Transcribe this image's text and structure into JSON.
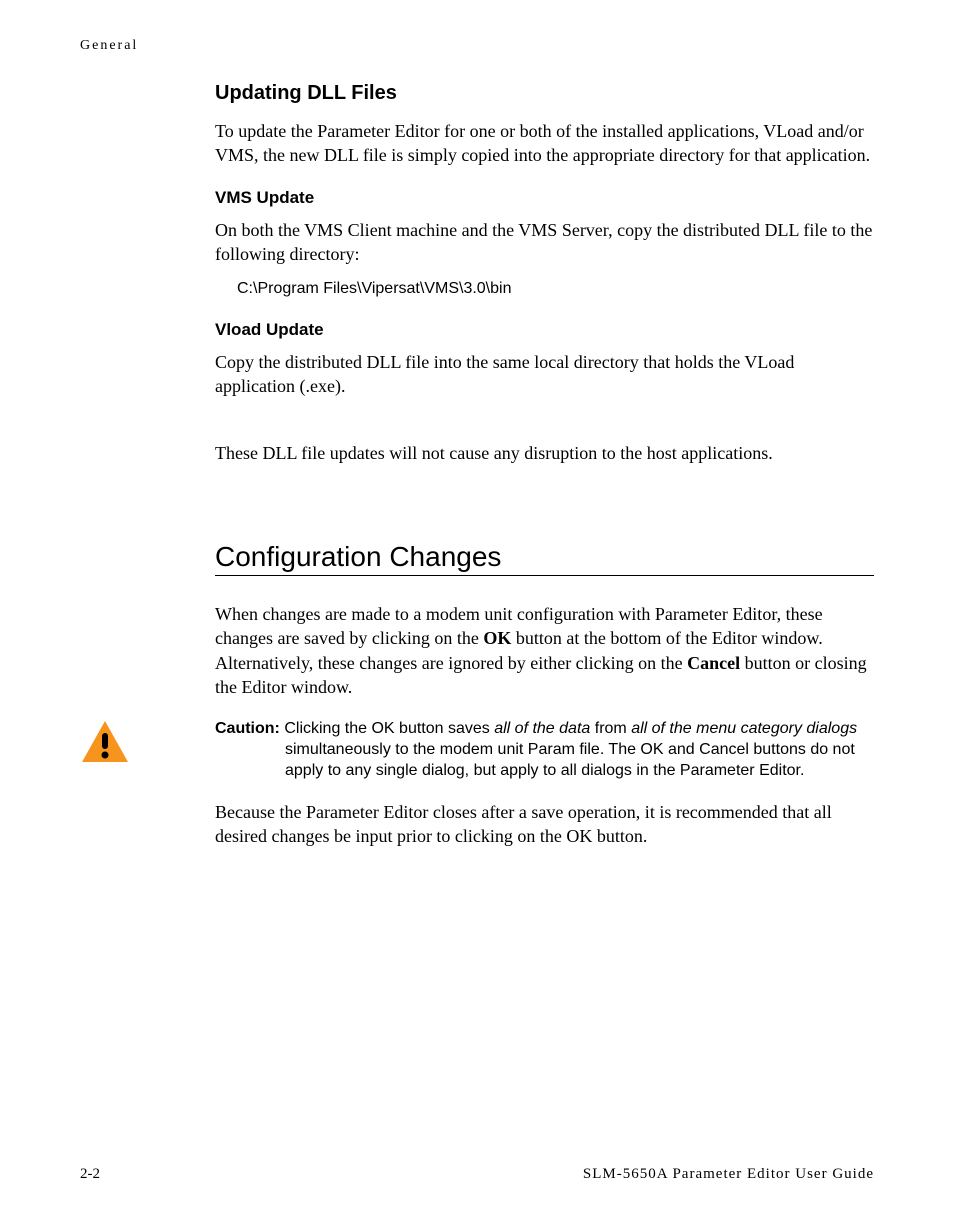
{
  "header": {
    "section_label": "General"
  },
  "section1": {
    "title": "Updating DLL Files",
    "intro": "To update the Parameter Editor for one or both of the installed applications, VLoad and/or VMS, the new DLL file is simply copied into the appropriate directory for that application.",
    "sub1": {
      "title": "VMS Update",
      "text": "On both the VMS Client machine and the VMS Server, copy the distributed DLL file to the following directory:",
      "path": "C:\\Program Files\\Vipersat\\VMS\\3.0\\bin"
    },
    "sub2": {
      "title": "Vload Update",
      "text": "Copy the distributed DLL file into the same local directory that holds the VLoad application (.exe)."
    },
    "note": "These DLL file updates will not cause any disruption to the host applications."
  },
  "section2": {
    "title": "Configuration Changes",
    "para1_a": "When changes are made to a modem unit configuration with Parameter Editor, these changes are saved by clicking on the ",
    "para1_ok": "OK",
    "para1_b": " button at the bottom of the Editor window. Alternatively, these changes are ignored by either clicking on the ",
    "para1_cancel": "Cancel",
    "para1_c": " button or closing the Editor window.",
    "caution": {
      "label": "Caution:",
      "line1_a": "Clicking the OK button saves ",
      "line1_italic1": "all of the data",
      "line1_b": " from ",
      "line1_italic2": "all of the menu category dialogs",
      "line1_c": " simultaneously to the modem unit Param file. The OK and Cancel buttons do not apply to any single dialog, but apply to all dialogs in the Parameter Editor."
    },
    "closing": "Because the Parameter Editor closes after a save operation, it is recommended that all desired changes be input prior to clicking on the OK button."
  },
  "footer": {
    "page": "2-2",
    "doc_title": "SLM-5650A Parameter Editor User Guide"
  }
}
